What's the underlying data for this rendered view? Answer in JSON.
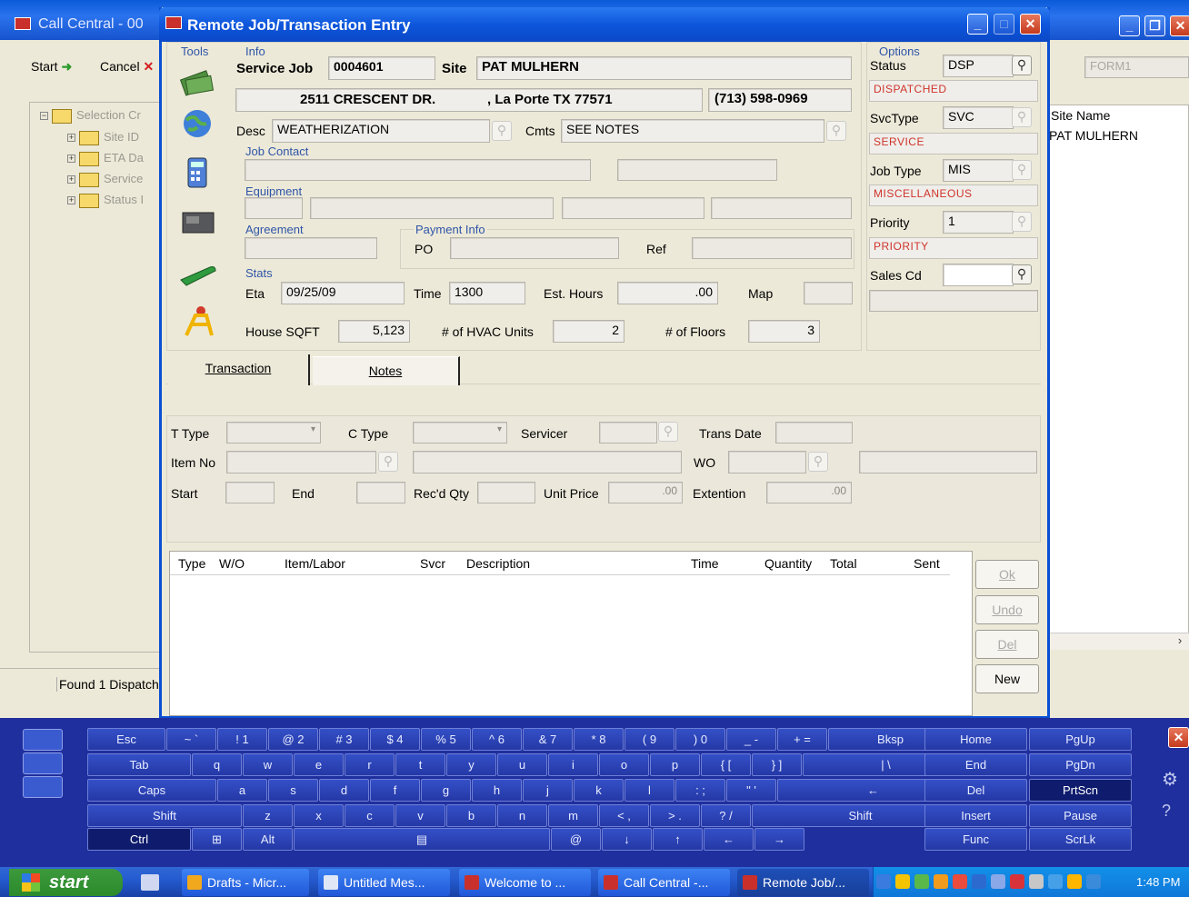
{
  "bg_window": {
    "title": "Call Central - 00",
    "start_label": "Start",
    "cancel_label": "Cancel",
    "form_field": "FORM1",
    "tree": [
      "Selection Cr",
      "Site ID",
      "ETA Da",
      "Service",
      "Status I"
    ],
    "site_name_header": "Site Name",
    "site_name_value": "PAT MULHERN",
    "status_text": "Found 1 Dispatch"
  },
  "dialog": {
    "title": "Remote Job/Transaction Entry",
    "tools_label": "Tools",
    "info_label": "Info",
    "service_job_label": "Service Job",
    "service_job_value": "0004601",
    "site_label": "Site",
    "site_value": "PAT MULHERN",
    "address": "2511 CRESCENT DR.",
    "city_state": ", La Porte TX 77571",
    "phone": "(713) 598-0969",
    "desc_label": "Desc",
    "desc_value": "WEATHERIZATION",
    "cmts_label": "Cmts",
    "cmts_value": "SEE NOTES",
    "job_contact_label": "Job Contact",
    "equipment_label": "Equipment",
    "agreement_label": "Agreement",
    "payment_info_label": "Payment Info",
    "po_label": "PO",
    "ref_label": "Ref",
    "stats_label": "Stats",
    "eta_label": "Eta",
    "eta_value": "09/25/09",
    "time_label": "Time",
    "time_value": "1300",
    "est_hours_label": "Est. Hours",
    "est_hours_value": ".00",
    "map_label": "Map",
    "house_sqft_label": "House SQFT",
    "house_sqft_value": "5,123",
    "hvac_label": "# of HVAC Units",
    "hvac_value": "2",
    "floors_label": "# of Floors",
    "floors_value": "3",
    "options_label": "Options",
    "status_label": "Status",
    "status_value": "DSP",
    "status_desc": "DISPATCHED",
    "svctype_label": "SvcType",
    "svctype_value": "SVC",
    "svctype_desc": "SERVICE",
    "jobtype_label": "Job Type",
    "jobtype_value": "MIS",
    "jobtype_desc": "MISCELLANEOUS",
    "priority_label": "Priority",
    "priority_value": "1",
    "priority_desc": "PRIORITY",
    "salescd_label": "Sales Cd",
    "tabs": [
      "Transaction",
      "Notes"
    ],
    "ttype_label": "T Type",
    "ctype_label": "C Type",
    "servicer_label": "Servicer",
    "trans_date_label": "Trans Date",
    "item_no_label": "Item No",
    "wo_label": "WO",
    "start_label": "Start",
    "end_label": "End",
    "recd_qty_label": "Rec'd Qty",
    "unit_price_label": "Unit Price",
    "unit_price_value": ".00",
    "extention_label": "Extention",
    "extention_value": ".00",
    "grid_headers": [
      "Type",
      "W/O",
      "Item/Labor",
      "Svcr",
      "Description",
      "Time",
      "Quantity",
      "Total",
      "Sent"
    ],
    "btn_ok": "Ok",
    "btn_undo": "Undo",
    "btn_del": "Del",
    "btn_new": "New"
  },
  "keyboard": {
    "row1": [
      "Esc",
      "~ `",
      "! 1",
      "@ 2",
      "# 3",
      "$ 4",
      "% 5",
      "^ 6",
      "& 7",
      "* 8",
      "( 9",
      ") 0",
      "_ -",
      "+ =",
      "Bksp"
    ],
    "row2": [
      "Tab",
      "q",
      "w",
      "e",
      "r",
      "t",
      "y",
      "u",
      "i",
      "o",
      "p",
      "{ [",
      "} ]",
      "| \\"
    ],
    "row3": [
      "Caps",
      "a",
      "s",
      "d",
      "f",
      "g",
      "h",
      "j",
      "k",
      "l",
      ": ;",
      "\" '",
      "←"
    ],
    "row4": [
      "Shift",
      "z",
      "x",
      "c",
      "v",
      "b",
      "n",
      "m",
      "< ,",
      "> .",
      "? /",
      "Shift"
    ],
    "row5": [
      "Ctrl",
      "⊞",
      "Alt",
      "▤",
      "@",
      "↓",
      "↑",
      "←",
      "→"
    ],
    "nav": [
      "Home",
      "PgUp",
      "End",
      "PgDn",
      "Del",
      "PrtScn",
      "Insert",
      "Pause",
      "Func",
      "ScrLk"
    ]
  },
  "taskbar": {
    "start": "start",
    "items": [
      "Drafts - Micr...",
      "Untitled Mes...",
      "Welcome to ...",
      "Call Central -...",
      "Remote Job/..."
    ],
    "clock": "1:48 PM"
  }
}
